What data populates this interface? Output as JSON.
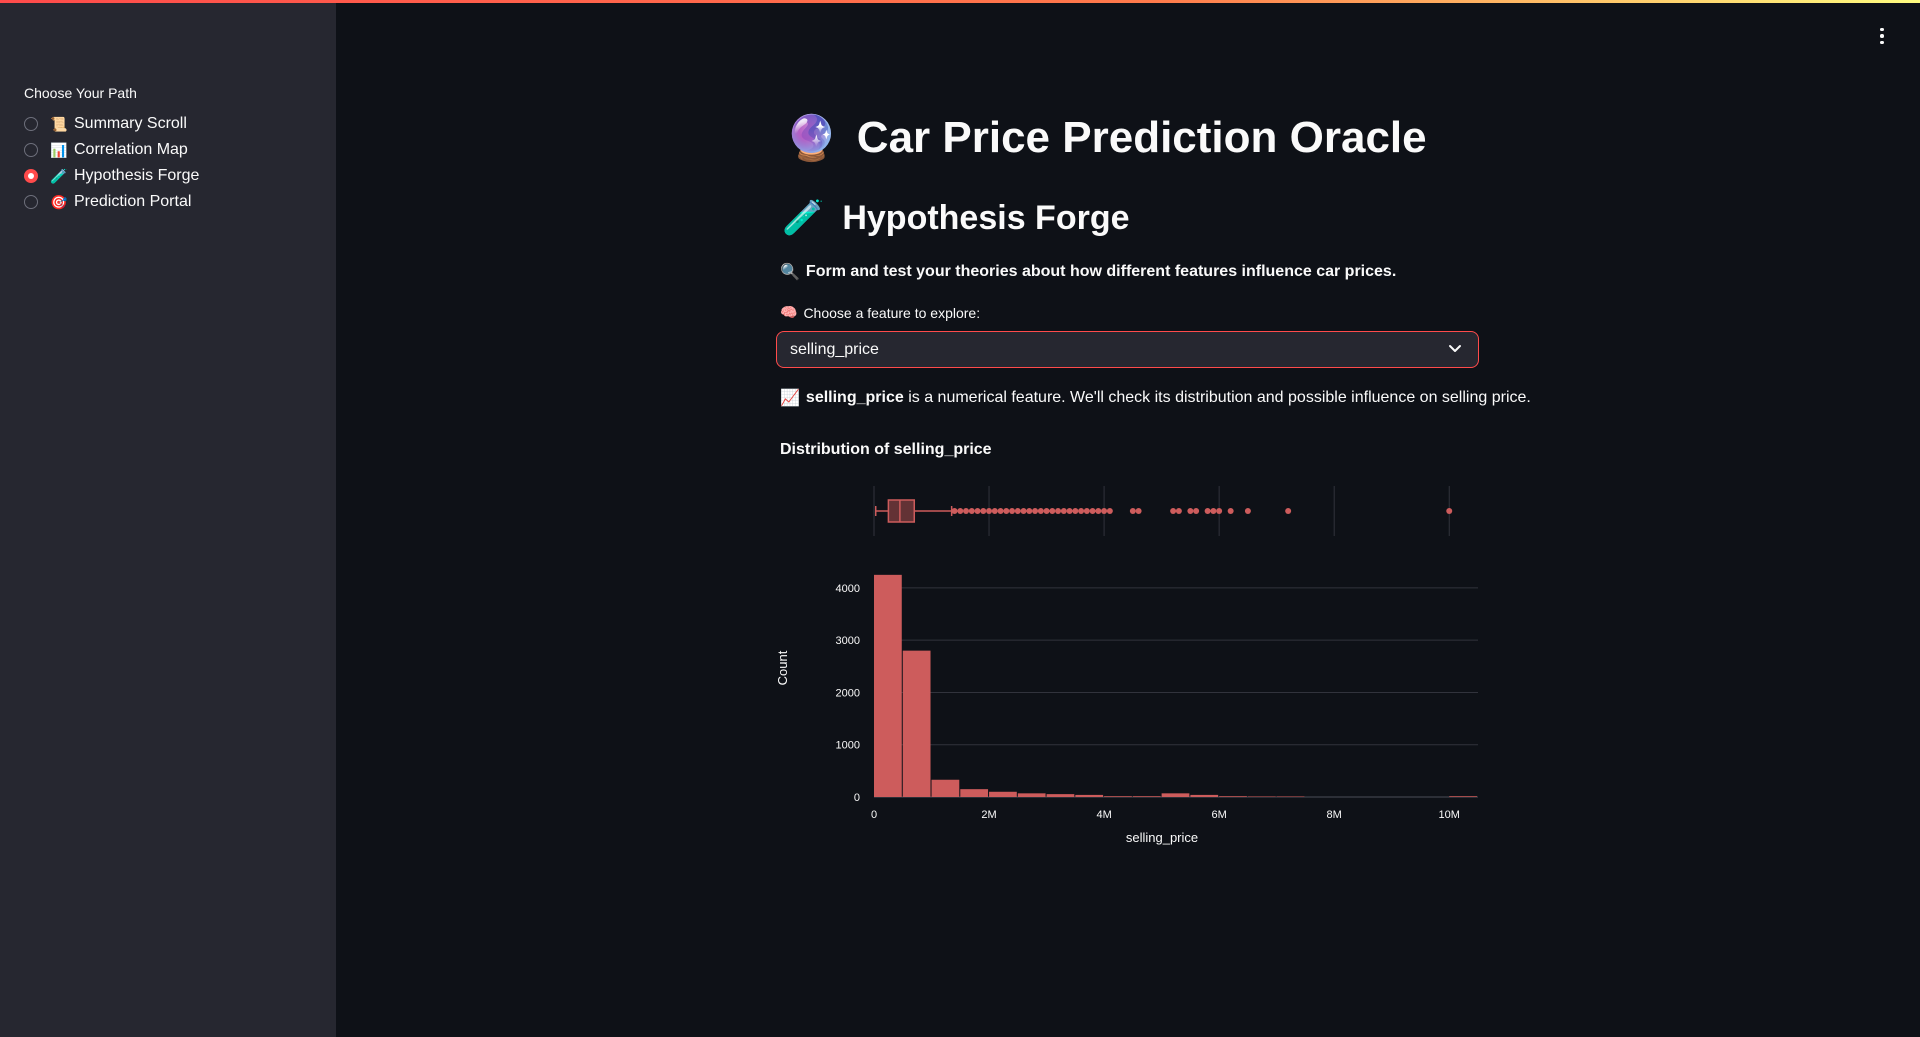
{
  "sidebar": {
    "title": "Choose Your Path",
    "items": [
      {
        "icon": "📜",
        "icon_name": "scroll-icon",
        "label": "Summary Scroll",
        "selected": false
      },
      {
        "icon": "📊",
        "icon_name": "bar-chart-icon",
        "label": "Correlation Map",
        "selected": false
      },
      {
        "icon": "🧪",
        "icon_name": "test-tube-icon",
        "label": "Hypothesis Forge",
        "selected": true
      },
      {
        "icon": "🎯",
        "icon_name": "target-icon",
        "label": "Prediction Portal",
        "selected": false
      }
    ]
  },
  "main": {
    "title": "Car Price Prediction Oracle",
    "title_icon": "🔮",
    "section_title": "Hypothesis Forge",
    "section_icon": "🧪",
    "intro_icon": "🔍",
    "intro": "Form and test your theories about how different features influence car prices.",
    "select_icon": "🧠",
    "select_label": "Choose a feature to explore:",
    "select_value": "selling_price",
    "info_icon": "📈",
    "info_feature": "selling_price",
    "info_text": "is a numerical feature. We'll check its distribution and possible influence on selling price.",
    "chart_heading": "Distribution of selling_price"
  },
  "colors": {
    "accent": "#ff4b4b",
    "bar": "#cd5c5c",
    "background": "#0e1117",
    "sidebar": "#262730"
  },
  "chart_data": {
    "type": "histogram",
    "title": "Distribution of selling_price",
    "xlabel": "selling_price",
    "ylabel": "Count",
    "xlim": [
      0,
      10500000
    ],
    "ylim": [
      0,
      4400
    ],
    "x_ticks": [
      0,
      2000000,
      4000000,
      6000000,
      8000000,
      10000000
    ],
    "x_tick_labels": [
      "0",
      "2M",
      "4M",
      "6M",
      "8M",
      "10M"
    ],
    "y_ticks": [
      0,
      1000,
      2000,
      3000,
      4000
    ],
    "y_tick_labels": [
      "0",
      "1000",
      "2000",
      "3000",
      "4000"
    ],
    "bin_width": 500000,
    "bins": [
      0,
      500000,
      1000000,
      1500000,
      2000000,
      2500000,
      3000000,
      3500000,
      4000000,
      4500000,
      5000000,
      5500000,
      6000000,
      6500000,
      7000000,
      7500000,
      8000000,
      8500000,
      9000000,
      9500000,
      10000000
    ],
    "values": [
      4250,
      2800,
      330,
      150,
      100,
      70,
      55,
      40,
      15,
      15,
      70,
      40,
      15,
      10,
      10,
      0,
      0,
      0,
      0,
      0,
      15
    ],
    "boxplot": {
      "min": 30000,
      "q1": 250000,
      "median": 450000,
      "q3": 700000,
      "upper_fence": 1350000,
      "outliers": [
        1400000,
        1500000,
        1600000,
        1700000,
        1800000,
        1900000,
        2000000,
        2100000,
        2200000,
        2300000,
        2400000,
        2500000,
        2600000,
        2700000,
        2800000,
        2900000,
        3000000,
        3100000,
        3200000,
        3300000,
        3400000,
        3500000,
        3600000,
        3700000,
        3800000,
        3900000,
        4000000,
        4100000,
        4500000,
        4600000,
        5200000,
        5300000,
        5500000,
        5600000,
        5800000,
        5900000,
        6000000,
        6200000,
        6500000,
        7200000,
        10000000
      ]
    },
    "grid": true,
    "legend": "none"
  }
}
